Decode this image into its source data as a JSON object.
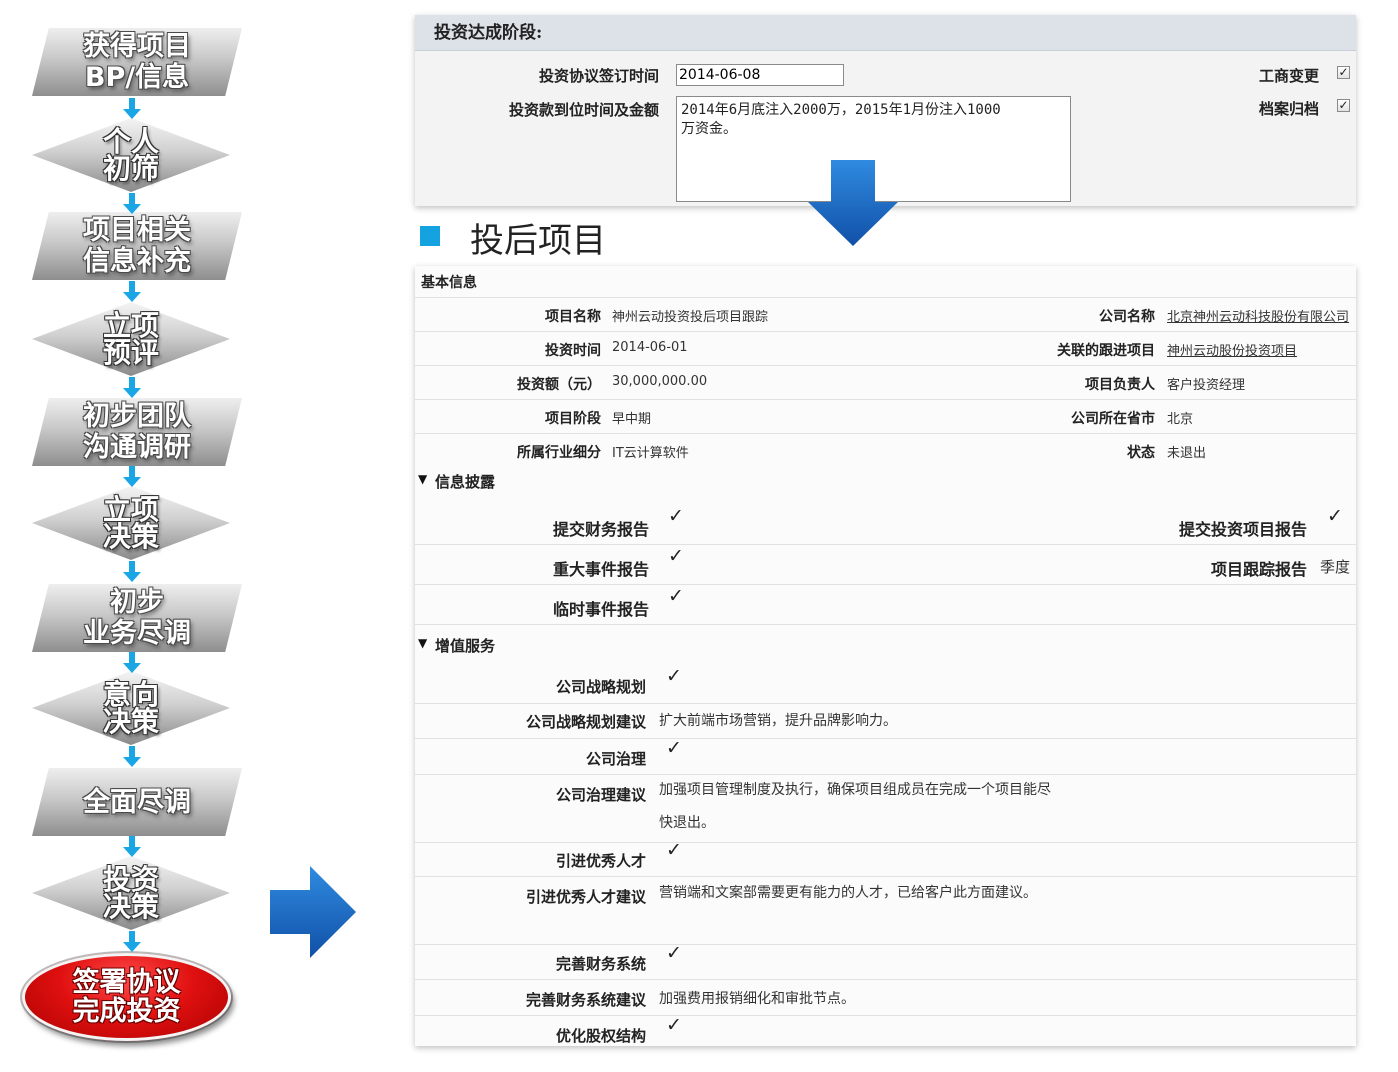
{
  "flow": {
    "steps": [
      {
        "label": "获得项目\nBP/信息",
        "shape": "parallelogram"
      },
      {
        "label": "个人\n初筛",
        "shape": "diamond"
      },
      {
        "label": "项目相关\n信息补充",
        "shape": "parallelogram"
      },
      {
        "label": "立项\n预评",
        "shape": "diamond"
      },
      {
        "label": "初步团队\n沟通调研",
        "shape": "parallelogram"
      },
      {
        "label": "立项\n决策",
        "shape": "diamond"
      },
      {
        "label": "初步\n业务尽调",
        "shape": "parallelogram"
      },
      {
        "label": "意向\n决策",
        "shape": "diamond"
      },
      {
        "label": "全面尽调",
        "shape": "parallelogram"
      },
      {
        "label": "投资\n决策",
        "shape": "diamond"
      },
      {
        "label": "签署协议\n完成投资",
        "shape": "ellipse"
      }
    ],
    "arrow_color": "#1aa6e4",
    "big_arrow_color": "#1565c0"
  },
  "top_panel": {
    "title": "投资达成阶段:",
    "sign_date_label": "投资协议签订时间",
    "sign_date_value": "2014-06-08",
    "funding_label": "投资款到位时间及金额",
    "funding_value": "2014年6月底注入2000万，2015年1月份注入1000\n万资金。",
    "business_change_label": "工商变更",
    "business_change_checked": true,
    "archive_label": "档案归档",
    "archive_checked": true
  },
  "section": {
    "title": "投后项目",
    "accent": "#14a3e0"
  },
  "basic": {
    "title": "基本信息",
    "rows": [
      {
        "left_label": "项目名称",
        "left_value": "神州云动投资投后项目跟踪",
        "right_label": "公司名称",
        "right_value": "北京神州云动科技股份有限公司",
        "right_link": true
      },
      {
        "left_label": "投资时间",
        "left_value": "2014-06-01",
        "right_label": "关联的跟进项目",
        "right_value": "神州云动股份投资项目",
        "right_link": true
      },
      {
        "left_label": "投资额（元）",
        "left_value": "30,000,000.00",
        "right_label": "项目负责人",
        "right_value": "客户投资经理",
        "right_link": false
      },
      {
        "left_label": "项目阶段",
        "left_value": "早中期",
        "right_label": "公司所在省市",
        "right_value": "北京",
        "right_link": false
      },
      {
        "left_label": "所属行业细分",
        "left_value": "IT云计算软件",
        "right_label": "状态",
        "right_value": "未退出",
        "right_link": false
      }
    ]
  },
  "disclosure": {
    "title": "信息披露",
    "financial_report": "提交财务报告",
    "investment_report": "提交投资项目报告",
    "major_event_report": "重大事件报告",
    "tracking_report": "项目跟踪报告",
    "tracking_report_value": "季度",
    "temp_event_report": "临时事件报告"
  },
  "value_added": {
    "title": "增值服务",
    "items": [
      {
        "label": "公司战略规划",
        "type": "check"
      },
      {
        "label": "公司战略规划建议",
        "type": "text",
        "value": "扩大前端市场营销，提升品牌影响力。"
      },
      {
        "label": "公司治理",
        "type": "check"
      },
      {
        "label": "公司治理建议",
        "type": "text",
        "value": "加强项目管理制度及执行，确保项目组成员在完成一个项目能尽快退出。"
      },
      {
        "label": "引进优秀人才",
        "type": "check"
      },
      {
        "label": "引进优秀人才建议",
        "type": "text",
        "value": "营销端和文案部需要更有能力的人才，已给客户此方面建议。"
      },
      {
        "label": "完善财务系统",
        "type": "check"
      },
      {
        "label": "完善财务系统建议",
        "type": "text",
        "value": "加强费用报销细化和审批节点。"
      },
      {
        "label": "优化股权结构",
        "type": "check"
      }
    ]
  },
  "icons": {
    "check": "✓",
    "collapse": "▼",
    "checkbox_checked": "checkbox-checked-icon"
  }
}
